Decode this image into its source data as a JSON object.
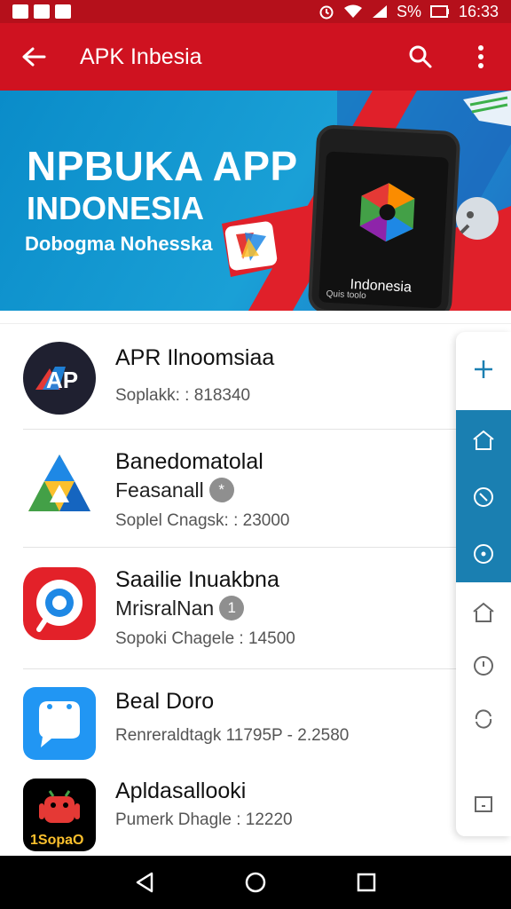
{
  "status_bar": {
    "battery": "S%",
    "time": "16:33"
  },
  "app_bar": {
    "title": "APK Inbesia"
  },
  "banner": {
    "title": "NPBUKA APP",
    "subtitle": "INDONESIA",
    "tagline": "Dobogma Nohesska",
    "phone_label": "Indonesia",
    "phone_caption": "Quis toolo"
  },
  "apps": [
    {
      "title": "APR Ilnoomsiaa",
      "subtitle": "",
      "badge": "",
      "meta": "Soplakk: : 818340",
      "icon": "ap-logo-icon",
      "color": "#222233"
    },
    {
      "title": "Banedomatolal",
      "subtitle": "Feasanall",
      "badge": "*",
      "meta": "Soplel Cnagsk: : 23000",
      "icon": "triangle-logo-icon",
      "color": "#ffffff"
    },
    {
      "title": "Saailie Inuakbna",
      "subtitle": "MrisralNan",
      "badge": "1",
      "meta": "Sopoki Chagele : 14500",
      "icon": "pin-logo-icon",
      "color": "#e32129"
    },
    {
      "title": "Beal Doro",
      "subtitle": "",
      "badge": "",
      "meta": "Renreraldtagk 11795P - 2.2580",
      "icon": "chat-bubble-icon",
      "color": "#2196f3"
    },
    {
      "title": "Apldasallooki",
      "subtitle": "",
      "badge": "",
      "meta": "Pumerk Dhagle : 12220",
      "icon": "android-robot-icon",
      "color": "#000000"
    }
  ],
  "side_rail": {
    "items": [
      "plus-icon",
      "home-icon",
      "rotate-icon",
      "target-icon",
      "home-icon",
      "clock-icon",
      "refresh-icon",
      "box-icon"
    ]
  },
  "colors": {
    "app_bar": "#cf1220",
    "status_bar": "#b5101b",
    "accent_blue": "#1a7fb1"
  }
}
